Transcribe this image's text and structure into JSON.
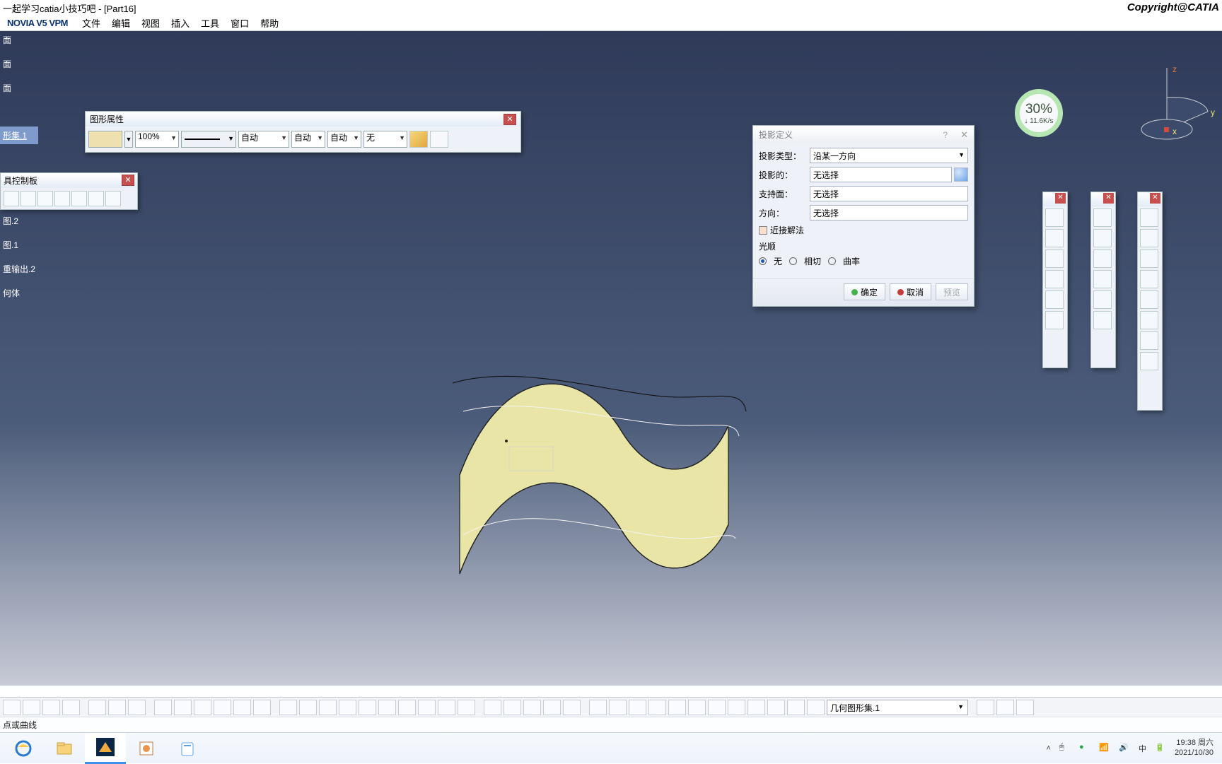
{
  "titlebar": {
    "text": "一起学习catia小技巧吧 - [Part16]",
    "copyright": "Copyright@CATIA"
  },
  "menu": {
    "vpm": "NOVIA V5 VPM",
    "items": [
      "文件",
      "编辑",
      "视图",
      "插入",
      "工具",
      "窗口",
      "帮助"
    ]
  },
  "spectree": {
    "items": [
      "面",
      "面",
      "面",
      "形集.1",
      "图.1",
      "图.2",
      "图.1",
      "重输出.2",
      "何体"
    ]
  },
  "gp": {
    "title": "图形属性",
    "opacity": "100%",
    "lineweight": "自动",
    "linetype": "自动",
    "layer": "自动",
    "symbol": "无"
  },
  "tcp": {
    "title": "具控制板"
  },
  "proj": {
    "title": "投影定义",
    "help": "?",
    "rows": {
      "type_label": "投影类型：",
      "type_value": "沿某一方向",
      "projected_label": "投影的：",
      "projected_value": "无选择",
      "support_label": "支持面：",
      "support_value": "无选择",
      "dir_label": "方向：",
      "dir_value": "无选择"
    },
    "near_label": "近接解法",
    "smooth_label": "光顺",
    "radios": {
      "none": "无",
      "tangent": "相切",
      "curvature": "曲率"
    },
    "ok": "确定",
    "cancel": "取消",
    "preview": "预览"
  },
  "gauge": {
    "pct": "30%",
    "speed": "↓ 11.6K/s"
  },
  "compass": {
    "z": "z",
    "y": "y",
    "x": "x"
  },
  "bottombar": {
    "body_selector": "几何图形集.1"
  },
  "status": {
    "hint": "点或曲线"
  },
  "taskbar": {
    "time": "19:38 周六",
    "date": "2021/10/30",
    "ime": "中"
  }
}
